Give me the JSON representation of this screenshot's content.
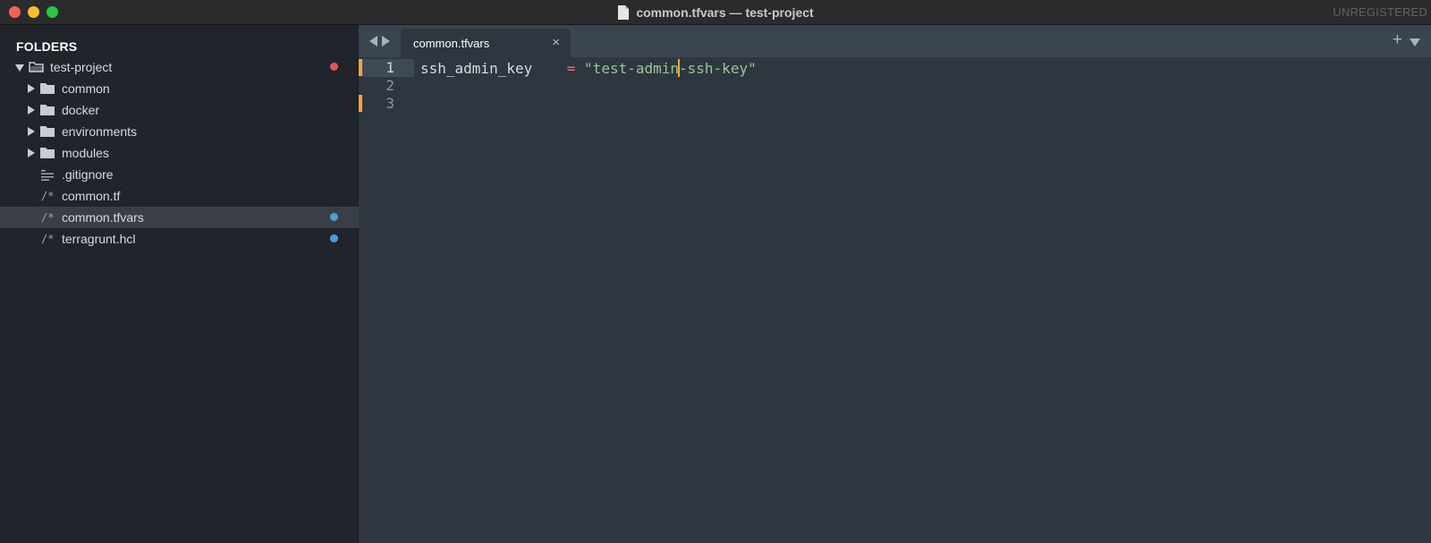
{
  "window": {
    "title": "common.tfvars — test-project",
    "license_status": "UNREGISTERED"
  },
  "sidebar": {
    "header": "FOLDERS",
    "project": {
      "label": "test-project",
      "badge_color": "#e8525c"
    },
    "items": [
      {
        "label": "common",
        "type": "folder"
      },
      {
        "label": "docker",
        "type": "folder"
      },
      {
        "label": "environments",
        "type": "folder"
      },
      {
        "label": "modules",
        "type": "folder"
      },
      {
        "label": ".gitignore",
        "type": "text-file",
        "icon": "lines-icon"
      },
      {
        "label": "common.tf",
        "type": "file",
        "prefix": "/*"
      },
      {
        "label": "common.tfvars",
        "type": "file",
        "prefix": "/*",
        "selected": true,
        "badge_color": "#4d9fd8"
      },
      {
        "label": "terragrunt.hcl",
        "type": "file",
        "prefix": "/*",
        "badge_color": "#4d9fd8"
      }
    ]
  },
  "tabs": [
    {
      "label": "common.tfvars",
      "close": "×",
      "active": true
    }
  ],
  "tabbar": {
    "plus": "+"
  },
  "editor": {
    "lines": [
      {
        "number": "1",
        "key": "ssh_admin_key",
        "op": "=",
        "value_before_cursor": "\"test-admin",
        "value_after_cursor": "-ssh-key\""
      },
      {
        "number": "2"
      },
      {
        "number": "3"
      }
    ],
    "colors": {
      "modified_marker": "#f6a83b",
      "keyword": "#d7dae0",
      "operator": "#f26d78",
      "string": "#99c794"
    }
  }
}
